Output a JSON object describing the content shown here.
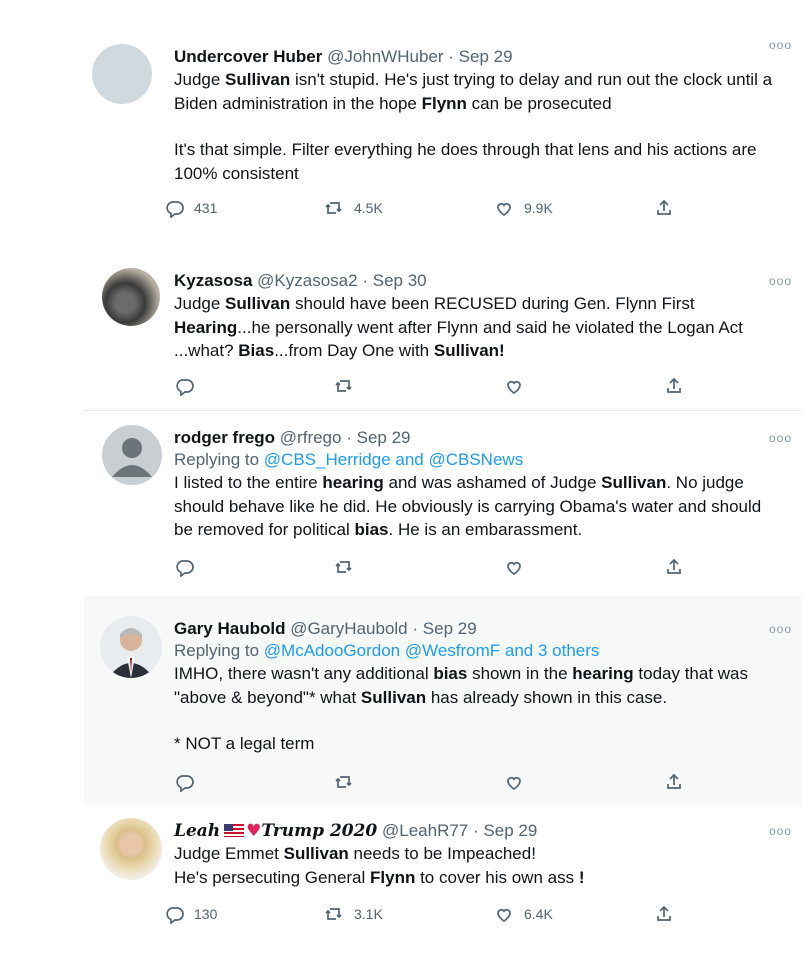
{
  "tweets": [
    {
      "name": "Undercover Huber",
      "handle": "@JohnWHuber",
      "date": "Sep 29",
      "paragraphs": [
        [
          [
            "Judge ",
            false
          ],
          [
            "Sullivan",
            true
          ],
          [
            " isn't stupid. He's just trying to delay and run out the clock until a Biden administration in the hope ",
            false
          ],
          [
            "Flynn",
            true
          ],
          [
            " can be prosecuted",
            false
          ]
        ],
        [
          [
            "It's that simple. Filter everything he does through that lens and his actions are 100% consistent",
            false
          ]
        ]
      ],
      "replies": "431",
      "retweets": "4.5K",
      "likes": "9.9K"
    },
    {
      "name": "Kyzasosa",
      "handle": "@Kyzasosa2",
      "date": "Sep 30",
      "paragraphs": [
        [
          [
            "Judge ",
            false
          ],
          [
            "Sullivan",
            true
          ],
          [
            " should have been RECUSED during Gen. Flynn First ",
            false
          ],
          [
            "Hearing",
            true
          ],
          [
            "...he personally went after Flynn and said he violated the Logan Act ...what?  ",
            false
          ],
          [
            "Bias",
            true
          ],
          [
            "...from Day One with ",
            false
          ],
          [
            "Sullivan!",
            true
          ]
        ]
      ],
      "replies": "",
      "retweets": "",
      "likes": ""
    },
    {
      "name": "rodger frego",
      "handle": "@rfrego",
      "date": "Sep 29",
      "replying_prefix": "Replying to",
      "replying_to": "@CBS_Herridge and @CBSNews",
      "paragraphs": [
        [
          [
            "I listed to the entire ",
            false
          ],
          [
            "hearing",
            true
          ],
          [
            " and was ashamed of Judge ",
            false
          ],
          [
            "Sullivan",
            true
          ],
          [
            ". No judge should behave like he did. He obviously is carrying Obama's water and should be removed for political ",
            false
          ],
          [
            "bias",
            true
          ],
          [
            ". He is an embarassment.",
            false
          ]
        ]
      ],
      "replies": "",
      "retweets": "",
      "likes": ""
    },
    {
      "name": "Gary Haubold",
      "handle": "@GaryHaubold",
      "date": "Sep 29",
      "replying_prefix": "Replying to",
      "replying_to": "@McAdooGordon @WesfromF and 3 others",
      "paragraphs": [
        [
          [
            "IMHO, there wasn't any additional ",
            false
          ],
          [
            "bias",
            true
          ],
          [
            " shown in the ",
            false
          ],
          [
            "hearing",
            true
          ],
          [
            " today that was \"above & beyond\"* what ",
            false
          ],
          [
            "Sullivan",
            true
          ],
          [
            " has already shown in this case.",
            false
          ]
        ],
        [
          [
            "* NOT a legal term",
            false
          ]
        ]
      ],
      "replies": "",
      "retweets": "",
      "likes": ""
    },
    {
      "name_part1": "Leah",
      "name_part2": "Trump",
      "name_part3": "2020",
      "heart_glyph": "♥",
      "handle": "@LeahR77",
      "date": "Sep 29",
      "paragraphs": [
        [
          [
            "Judge Emmet ",
            false
          ],
          [
            "Sullivan",
            true
          ],
          [
            " needs to be Impeached!",
            false
          ]
        ],
        [
          [
            "He's persecuting General ",
            false
          ],
          [
            "Flynn",
            true
          ],
          [
            " to cover his own ass ",
            false
          ],
          [
            "!",
            true
          ]
        ]
      ],
      "replies": "130",
      "retweets": "3.1K",
      "likes": "6.4K"
    }
  ],
  "ui": {
    "dot_separator": "·",
    "more_glyph": "ooo"
  },
  "icons": [
    "reply-icon",
    "retweet-icon",
    "like-icon",
    "share-icon",
    "more-icon"
  ]
}
